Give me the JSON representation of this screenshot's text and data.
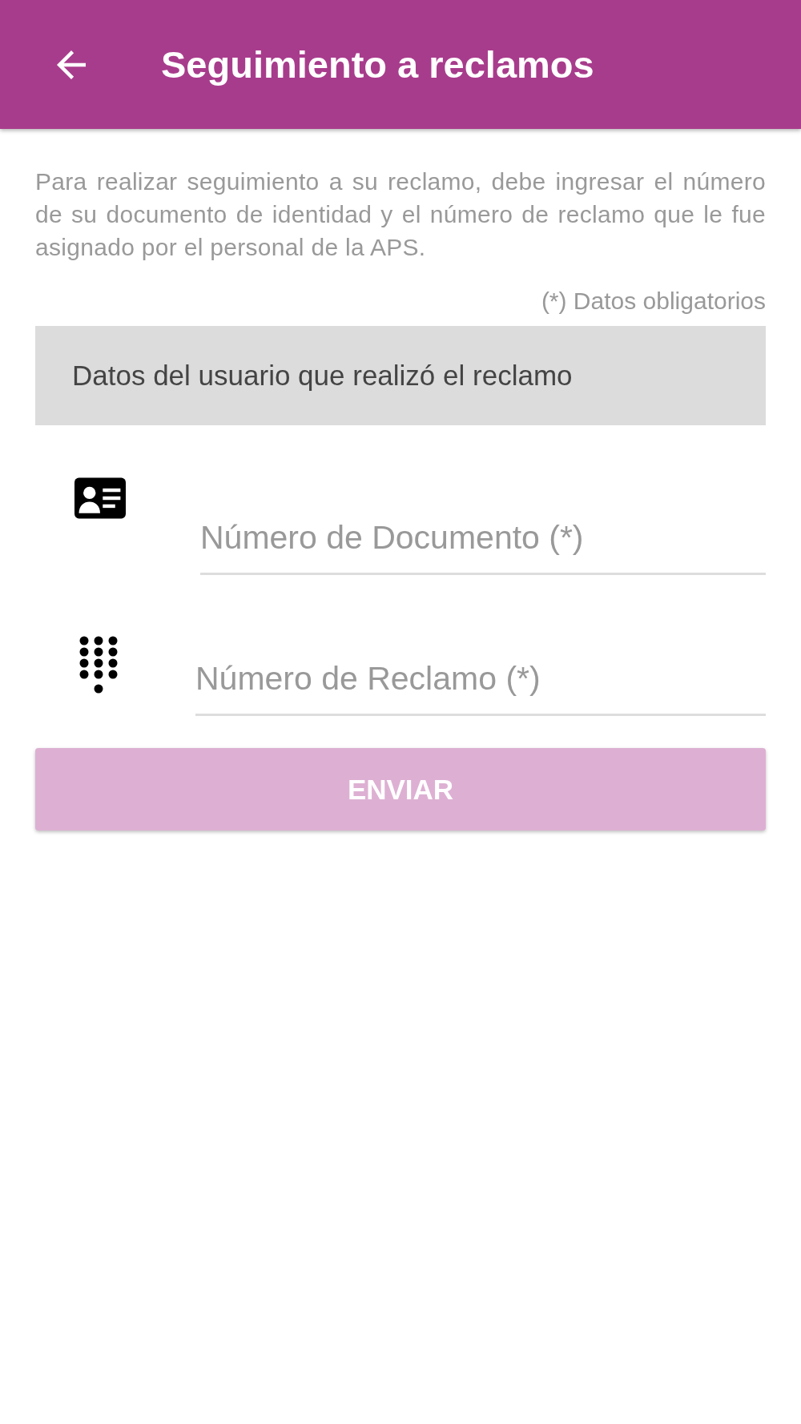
{
  "app_bar": {
    "title": "Seguimiento a reclamos"
  },
  "description": "Para realizar seguimiento a su reclamo, debe ingresar el número de su documento de identidad y el número de reclamo que le fue asignado por el personal de la APS.",
  "required_note": "(*) Datos obligatorios",
  "section_title": "Datos del usuario que realizó el reclamo",
  "fields": [
    {
      "placeholder": "Número de Documento (*)"
    },
    {
      "placeholder": "Número de Reclamo (*)"
    }
  ],
  "submit_button": {
    "label": "ENVIAR",
    "disabled": true
  }
}
